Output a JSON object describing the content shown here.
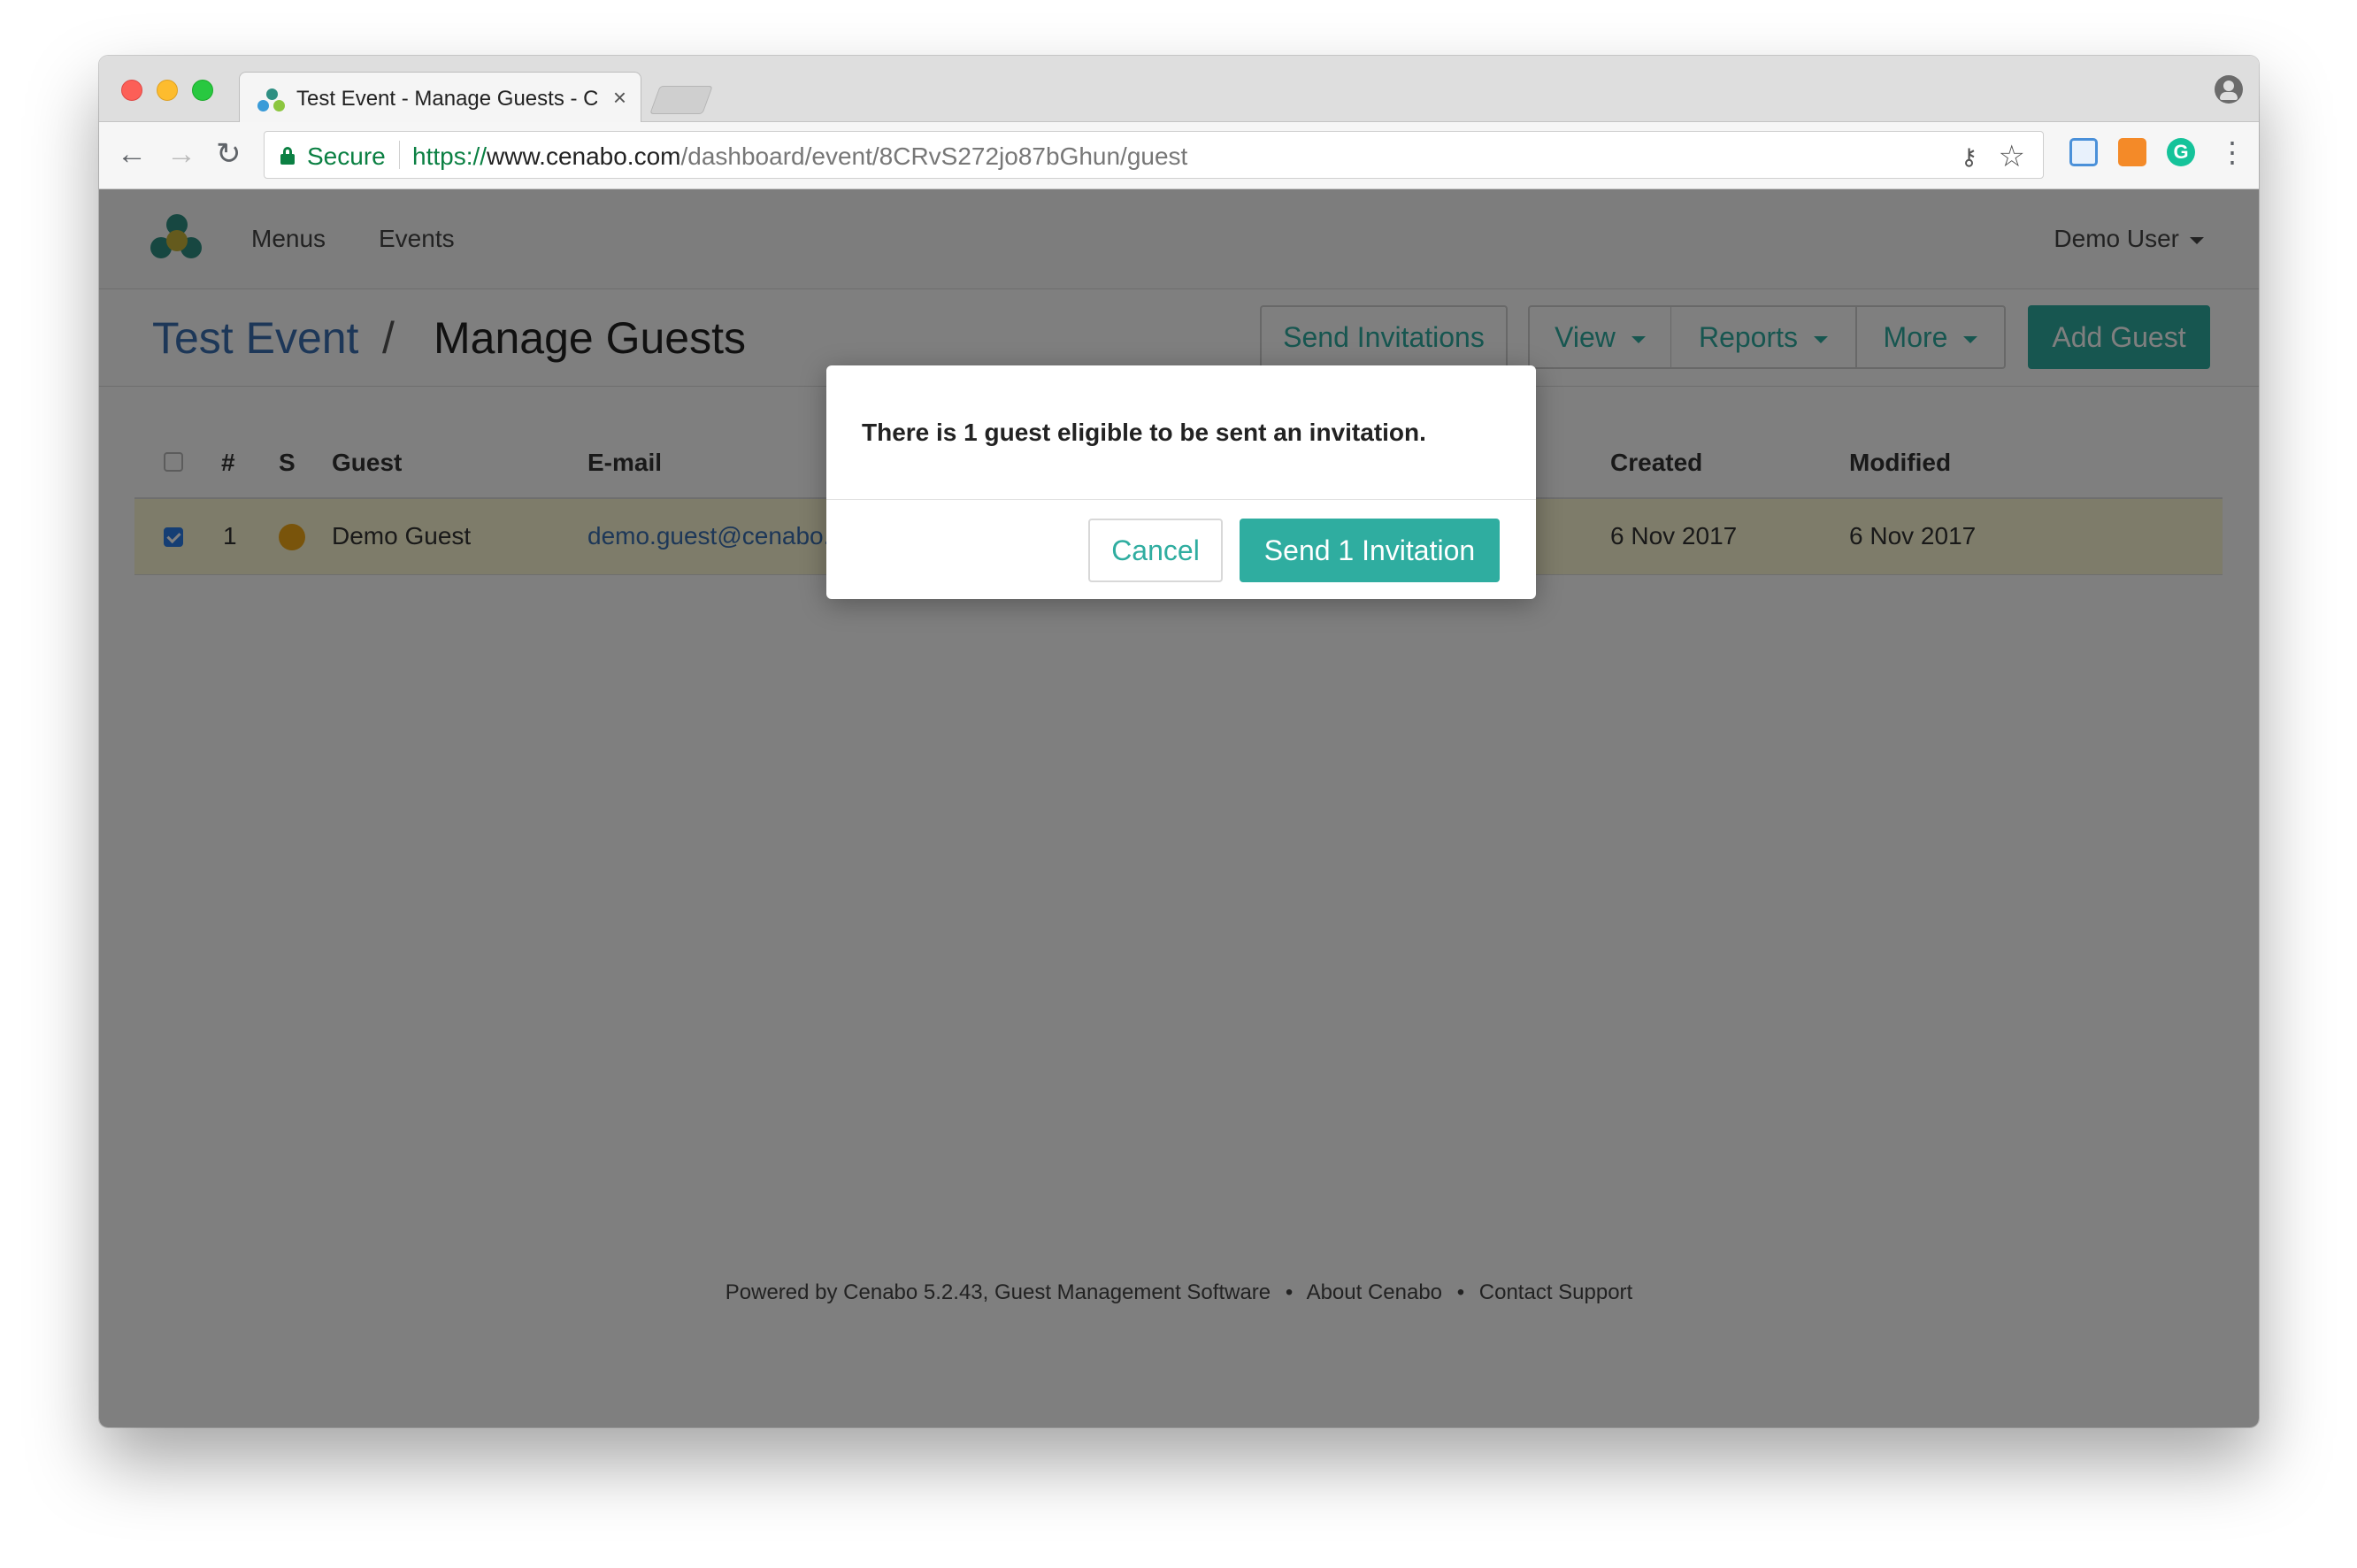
{
  "browser": {
    "tab_title": "Test Event - Manage Guests - Cenabo",
    "tab_close": "×",
    "secure_label": "Secure",
    "url_scheme": "https://",
    "url_host": "www.cenabo.com",
    "url_path": "/dashboard/event/8CRvS272jo87bGhun/guest",
    "extension_3_letter": "G",
    "icons": [
      "back-arrow-icon",
      "forward-arrow-icon",
      "reload-icon",
      "lock-icon",
      "key-icon",
      "star-icon",
      "menu-dots-icon",
      "profile-icon"
    ]
  },
  "app": {
    "nav": {
      "menus": "Menus",
      "events": "Events",
      "user": "Demo User"
    },
    "breadcrumb": {
      "event": "Test Event",
      "separator": "/",
      "page": "Manage Guests"
    },
    "actions": {
      "send_invitations": "Send Invitations",
      "view": "View",
      "reports": "Reports",
      "more": "More",
      "add_guest": "Add Guest"
    },
    "table": {
      "headers": {
        "number": "#",
        "status": "S",
        "guest": "Guest",
        "email": "E-mail",
        "created": "Created",
        "modified": "Modified"
      },
      "rows": [
        {
          "selected": true,
          "number": "1",
          "status_color": "#f3a916",
          "guest": "Demo Guest",
          "email": "demo.guest@cenabo.",
          "created": "6 Nov 2017",
          "modified": "6 Nov 2017"
        }
      ]
    },
    "footer": {
      "text": "Powered by Cenabo 5.2.43, Guest Management Software",
      "bullet_1": "•",
      "about": "About Cenabo",
      "bullet_2": "•",
      "support": "Contact Support"
    }
  },
  "modal": {
    "message": "There is 1 guest eligible to be sent an invitation.",
    "cancel": "Cancel",
    "confirm": "Send 1 Invitation"
  },
  "colors": {
    "accent": "#2fada0",
    "link": "#3a6fb0",
    "selected_row": "#fcf8d4",
    "status_pending": "#f3a916"
  }
}
